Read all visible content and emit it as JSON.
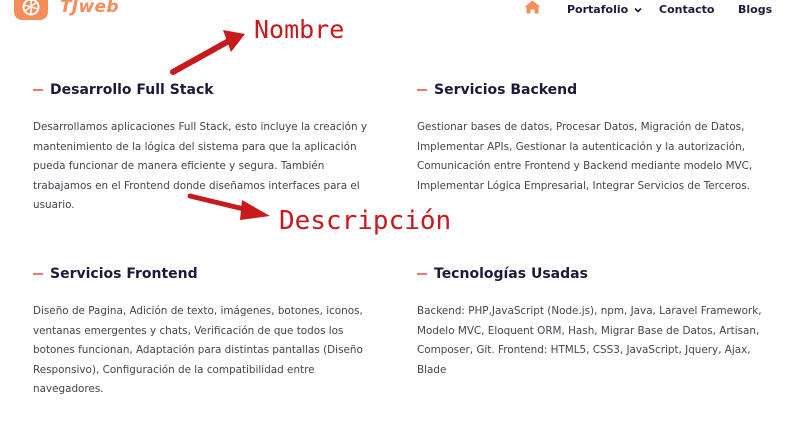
{
  "header": {
    "brand": "TJweb",
    "nav": [
      "Portafolio",
      "Contacto",
      "Blogs"
    ],
    "home_icon": "home-icon",
    "dropdown_icon": "chevron-down-icon",
    "accent_color": "#f58d5b",
    "text_color": "#1d1a3c"
  },
  "annotations": {
    "nombre": "Nombre",
    "descripcion": "Descripción",
    "color": "#c8191d"
  },
  "sections": [
    {
      "title": "Desarrollo Full Stack",
      "description": "Desarrollamos aplicaciones Full Stack, esto incluye la creación y mantenimiento de la lógica del sistema para que la aplicación pueda funcionar de manera eficiente y segura. También trabajamos en el Frontend donde diseñamos interfaces para el usuario."
    },
    {
      "title": "Servicios Backend",
      "description": "Gestionar bases de datos, Procesar Datos, Migración de Datos, Implementar APIs, Gestionar la autenticación y la autorización, Comunicación entre Frontend y Backend mediante modelo MVC, Implementar Lógica Empresarial, Integrar Servicios de Terceros."
    },
    {
      "title": "Servicios Frontend",
      "description": "Diseño de Pagina, Adición de texto, imágenes, botones, iconos, ventanas emergentes y chats, Verificación de que todos los botones funcionan, Adaptación para distintas pantallas (Diseño Responsivo), Configuración de la compatibilidad entre navegadores."
    },
    {
      "title": "Tecnologías Usadas",
      "description": "Backend: PHP,JavaScript (Node.js), npm, Java, Laravel Framework, Modelo MVC, Eloquent ORM, Hash, Migrar Base de Datos, Artisan, Composer, Git. Frontend: HTML5, CSS3, JavaScript, Jquery, Ajax, Blade"
    }
  ]
}
